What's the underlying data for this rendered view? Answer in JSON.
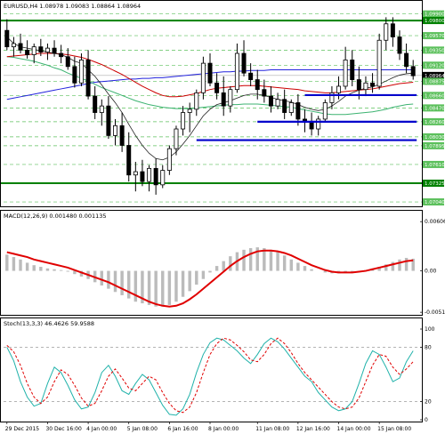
{
  "chart_data": [
    {
      "type": "candlestick",
      "title": "EURUSD,H4  1.08978 1.09083 1.08864 1.08964",
      "x_labels": [
        "29 Dec 2015",
        "30 Dec 16:00",
        "4 Jan 00:00",
        "5 Jan 08:00",
        "6 Jan 16:00",
        "8 Jan 00:00",
        "11 Jan 08:00",
        "12 Jan 16:00",
        "14 Jan 00:00",
        "15 Jan 08:00"
      ],
      "y_ticks": [
        "1.09900",
        "1.09800",
        "1.09570",
        "1.09350",
        "1.09120",
        "1.08964",
        "1.08875",
        "1.08660",
        "1.08470",
        "1.08260",
        "1.08030",
        "1.07895",
        "1.07610",
        "1.07325",
        "1.07040"
      ],
      "ylim": [
        1.07,
        1.0995
      ],
      "highlighted_levels": {
        "green": [
          "1.09800",
          "1.07325"
        ],
        "green_light": [
          "1.09570",
          "1.09350",
          "1.09120",
          "1.08875",
          "1.08660",
          "1.08470",
          "1.08260",
          "1.08030",
          "1.07895",
          "1.07610",
          "1.07040"
        ]
      },
      "current_price": "1.08964",
      "candles": [
        [
          1.0965,
          1.0982,
          1.0935,
          1.094
        ],
        [
          1.094,
          1.0955,
          1.0925,
          1.0945
        ],
        [
          1.0945,
          1.096,
          1.093,
          1.0935
        ],
        [
          1.0935,
          1.095,
          1.0922,
          1.0928
        ],
        [
          1.0928,
          1.0945,
          1.0915,
          1.094
        ],
        [
          1.094,
          1.0952,
          1.0926,
          1.0932
        ],
        [
          1.0932,
          1.0945,
          1.092,
          1.0938
        ],
        [
          1.0938,
          1.095,
          1.0925,
          1.093
        ],
        [
          1.093,
          1.0943,
          1.0915,
          1.0925
        ],
        [
          1.0925,
          1.0938,
          1.0905,
          1.091
        ],
        [
          1.091,
          1.0925,
          1.0878,
          1.0885
        ],
        [
          1.0885,
          1.093,
          1.088,
          1.092
        ],
        [
          1.092,
          1.0935,
          1.086,
          1.0865
        ],
        [
          1.0865,
          1.088,
          1.083,
          1.084
        ],
        [
          1.084,
          1.086,
          1.082,
          1.085
        ],
        [
          1.085,
          1.0865,
          1.08,
          1.0805
        ],
        [
          1.0805,
          1.083,
          1.079,
          1.082
        ],
        [
          1.082,
          1.084,
          1.078,
          1.079
        ],
        [
          1.079,
          1.081,
          1.0735,
          1.0745
        ],
        [
          1.0745,
          1.0765,
          1.072,
          1.075
        ],
        [
          1.075,
          1.0768,
          1.0728,
          1.0735
        ],
        [
          1.0735,
          1.076,
          1.072,
          1.0755
        ],
        [
          1.0755,
          1.077,
          1.0715,
          1.073
        ],
        [
          1.073,
          1.076,
          1.0725,
          1.0752
        ],
        [
          1.0752,
          1.079,
          1.0745,
          1.0785
        ],
        [
          1.0785,
          1.082,
          1.0775,
          1.0815
        ],
        [
          1.0815,
          1.085,
          1.0805,
          1.084
        ],
        [
          1.084,
          1.0855,
          1.081,
          1.0845
        ],
        [
          1.0845,
          1.0875,
          1.0835,
          1.087
        ],
        [
          1.087,
          1.0925,
          1.086,
          1.0915
        ],
        [
          1.0915,
          1.093,
          1.088,
          1.0885
        ],
        [
          1.0885,
          1.09,
          1.086,
          1.087
        ],
        [
          1.087,
          1.0895,
          1.0835,
          1.085
        ],
        [
          1.085,
          1.088,
          1.084,
          1.0875
        ],
        [
          1.0875,
          1.0945,
          1.087,
          1.093
        ],
        [
          1.093,
          1.095,
          1.0895,
          1.09
        ],
        [
          1.09,
          1.0915,
          1.088,
          1.089
        ],
        [
          1.089,
          1.0905,
          1.086,
          1.0875
        ],
        [
          1.0875,
          1.089,
          1.0855,
          1.0865
        ],
        [
          1.0865,
          1.088,
          1.084,
          1.085
        ],
        [
          1.085,
          1.087,
          1.0845,
          1.086
        ],
        [
          1.086,
          1.0875,
          1.083,
          1.084
        ],
        [
          1.084,
          1.086,
          1.0835,
          1.0855
        ],
        [
          1.0855,
          1.0868,
          1.082,
          1.083
        ],
        [
          1.083,
          1.0845,
          1.081,
          1.0825
        ],
        [
          1.0825,
          1.084,
          1.0805,
          1.0815
        ],
        [
          1.0815,
          1.0835,
          1.0805,
          1.083
        ],
        [
          1.083,
          1.086,
          1.0825,
          1.0855
        ],
        [
          1.0855,
          1.088,
          1.0845,
          1.087
        ],
        [
          1.087,
          1.0895,
          1.086,
          1.088
        ],
        [
          1.088,
          1.094,
          1.0875,
          1.092
        ],
        [
          1.092,
          1.0935,
          1.088,
          1.089
        ],
        [
          1.089,
          1.091,
          1.086,
          1.0875
        ],
        [
          1.0875,
          1.0895,
          1.0865,
          1.0885
        ],
        [
          1.0885,
          1.09,
          1.087,
          1.088
        ],
        [
          1.088,
          1.096,
          1.0875,
          1.095
        ],
        [
          1.095,
          1.0985,
          1.0935,
          1.0975
        ],
        [
          1.0975,
          1.0985,
          1.094,
          1.0955
        ],
        [
          1.0955,
          1.0965,
          1.092,
          1.093
        ],
        [
          1.093,
          1.0945,
          1.09,
          1.091
        ],
        [
          1.091,
          1.092,
          1.089,
          1.0896
        ]
      ],
      "sma_black": [
        1.0955,
        1.0945,
        1.094,
        1.0938,
        1.0936,
        1.0934,
        1.0932,
        1.093,
        1.0928,
        1.0924,
        1.0918,
        1.0915,
        1.0905,
        1.0895,
        1.0882,
        1.0868,
        1.0855,
        1.084,
        1.0822,
        1.0805,
        1.079,
        1.0778,
        1.077,
        1.0768,
        1.0772,
        1.078,
        1.0792,
        1.0805,
        1.082,
        1.0835,
        1.0845,
        1.0852,
        1.0855,
        1.0858,
        1.0862,
        1.0866,
        1.0868,
        1.0868,
        1.0866,
        1.0863,
        1.086,
        1.0858,
        1.0856,
        1.0852,
        1.0848,
        1.0845,
        1.0843,
        1.0845,
        1.085,
        1.0857,
        1.0865,
        1.087,
        1.0874,
        1.0877,
        1.0879,
        1.0883,
        1.0888,
        1.0893,
        1.0897,
        1.0899,
        1.09
      ],
      "ma_red": [
        1.0925,
        1.0926,
        1.0927,
        1.0928,
        1.0929,
        1.093,
        1.093,
        1.093,
        1.0929,
        1.0928,
        1.0926,
        1.0924,
        1.0921,
        1.0917,
        1.0913,
        1.0908,
        1.0903,
        1.0898,
        1.0892,
        1.0886,
        1.088,
        1.0875,
        1.087,
        1.0866,
        1.0864,
        1.0864,
        1.0865,
        1.0867,
        1.0869,
        1.0872,
        1.0875,
        1.0877,
        1.0878,
        1.0879,
        1.088,
        1.0881,
        1.0881,
        1.0881,
        1.088,
        1.0879,
        1.0878,
        1.0877,
        1.0876,
        1.0875,
        1.0873,
        1.0872,
        1.0871,
        1.087,
        1.087,
        1.0871,
        1.0872,
        1.0873,
        1.0874,
        1.0875,
        1.0876,
        1.0878,
        1.088,
        1.0882,
        1.0884,
        1.0885,
        1.0886
      ],
      "ma_blue": [
        1.086,
        1.0862,
        1.0864,
        1.0866,
        1.0868,
        1.087,
        1.0872,
        1.0874,
        1.0876,
        1.0878,
        1.088,
        1.0882,
        1.0884,
        1.0886,
        1.0887,
        1.0888,
        1.0889,
        1.089,
        1.0891,
        1.0891,
        1.0892,
        1.0892,
        1.0893,
        1.0893,
        1.0894,
        1.0895,
        1.0896,
        1.0897,
        1.0898,
        1.0899,
        1.09,
        1.0901,
        1.0902,
        1.0902,
        1.0903,
        1.0903,
        1.0904,
        1.0904,
        1.0904,
        1.0905,
        1.0905,
        1.0905,
        1.0905,
        1.0905,
        1.0905,
        1.0905,
        1.0905,
        1.0905,
        1.0905,
        1.0905,
        1.0905,
        1.0905,
        1.0905,
        1.0905,
        1.0905,
        1.0905,
        1.0905,
        1.0905,
        1.0905,
        1.0905,
        1.0905
      ],
      "ma_green": [
        1.0925,
        1.0924,
        1.0922,
        1.092,
        1.0918,
        1.0915,
        1.0912,
        1.0908,
        1.0905,
        1.09,
        1.0896,
        1.0892,
        1.0888,
        1.0883,
        1.0878,
        1.0874,
        1.087,
        1.0866,
        1.0862,
        1.0858,
        1.0855,
        1.0852,
        1.085,
        1.0848,
        1.0847,
        1.0846,
        1.0846,
        1.0846,
        1.0847,
        1.0848,
        1.0849,
        1.085,
        1.0851,
        1.0852,
        1.0852,
        1.0853,
        1.0853,
        1.0853,
        1.0852,
        1.0851,
        1.085,
        1.0849,
        1.0848,
        1.0846,
        1.0844,
        1.0842,
        1.084,
        1.0838,
        1.0837,
        1.0837,
        1.0837,
        1.0838,
        1.0839,
        1.084,
        1.0841,
        1.0843,
        1.0845,
        1.0848,
        1.085,
        1.0852,
        1.0853
      ],
      "support_resistance_lines": [
        {
          "price": 1.08665,
          "x_from_index": 44,
          "x_to_index": 60,
          "color": "#0000cc"
        },
        {
          "price": 1.0826,
          "x_from_index": 37,
          "x_to_index": 60,
          "color": "#0000cc"
        },
        {
          "price": 1.0798,
          "x_from_index": 28,
          "x_to_index": 60,
          "color": "#0000cc"
        }
      ]
    },
    {
      "type": "bar",
      "title": "MACD(12,26,9) 0.001480 0.001135",
      "y_ticks": [
        "0.006069",
        "0.00",
        "-0.005105"
      ],
      "ylim": [
        -0.0052,
        0.0062
      ],
      "histogram": [
        0.002,
        0.0017,
        0.0014,
        0.001,
        0.0007,
        0.0005,
        0.0003,
        0.0002,
        0.0001,
        -0.0001,
        -0.0004,
        -0.0007,
        -0.001,
        -0.0014,
        -0.0018,
        -0.0022,
        -0.0026,
        -0.003,
        -0.0034,
        -0.0038,
        -0.004,
        -0.0042,
        -0.0044,
        -0.0044,
        -0.0042,
        -0.0038,
        -0.0032,
        -0.0025,
        -0.0017,
        -0.001,
        -0.0002,
        0.0006,
        0.0012,
        0.0018,
        0.0023,
        0.0026,
        0.0028,
        0.0029,
        0.0028,
        0.0026,
        0.0023,
        0.0019,
        0.0014,
        0.001,
        0.0006,
        0.0002,
        0.0,
        -0.0002,
        -0.0003,
        -0.0003,
        -0.0002,
        -0.0001,
        0.0,
        0.0001,
        0.0003,
        0.0005,
        0.0008,
        0.0011,
        0.0014,
        0.0016,
        0.0015
      ],
      "signal": [
        0.0023,
        0.0021,
        0.0019,
        0.0017,
        0.0014,
        0.0012,
        0.001,
        0.0008,
        0.0006,
        0.0004,
        0.0001,
        -0.0002,
        -0.0005,
        -0.0008,
        -0.0011,
        -0.0014,
        -0.0018,
        -0.0022,
        -0.0026,
        -0.003,
        -0.0034,
        -0.0038,
        -0.0041,
        -0.0043,
        -0.0044,
        -0.0043,
        -0.004,
        -0.0035,
        -0.0029,
        -0.0022,
        -0.0015,
        -0.0008,
        -0.0001,
        0.0006,
        0.0012,
        0.0017,
        0.0021,
        0.0024,
        0.0025,
        0.0025,
        0.0024,
        0.0022,
        0.0019,
        0.0015,
        0.0011,
        0.0007,
        0.0004,
        0.0001,
        -0.0001,
        -0.0002,
        -0.0002,
        -0.0002,
        -0.0001,
        0.0,
        0.0002,
        0.0004,
        0.0006,
        0.0008,
        0.001,
        0.0012,
        0.0013
      ]
    },
    {
      "type": "line",
      "title": "Stoch(13,3,3) 46.4626 59.9588",
      "y_ticks": [
        "100",
        "80",
        "20",
        "0"
      ],
      "ylim": [
        0,
        100
      ],
      "main": [
        80,
        65,
        42,
        25,
        15,
        18,
        40,
        58,
        52,
        38,
        22,
        12,
        14,
        30,
        52,
        60,
        48,
        32,
        28,
        40,
        50,
        44,
        30,
        16,
        6,
        5,
        12,
        28,
        52,
        72,
        85,
        90,
        88,
        82,
        76,
        68,
        62,
        72,
        84,
        90,
        86,
        78,
        68,
        58,
        48,
        42,
        30,
        22,
        14,
        10,
        12,
        20,
        40,
        62,
        76,
        72,
        58,
        42,
        46,
        64,
        76
      ],
      "signal": [
        82,
        75,
        60,
        40,
        25,
        18,
        25,
        42,
        55,
        50,
        38,
        24,
        15,
        18,
        32,
        48,
        56,
        46,
        35,
        32,
        40,
        48,
        44,
        30,
        18,
        10,
        8,
        14,
        30,
        52,
        72,
        84,
        90,
        88,
        82,
        75,
        66,
        64,
        72,
        84,
        90,
        84,
        74,
        62,
        52,
        44,
        36,
        28,
        20,
        14,
        12,
        14,
        24,
        42,
        60,
        72,
        70,
        58,
        50,
        56,
        64
      ]
    }
  ]
}
